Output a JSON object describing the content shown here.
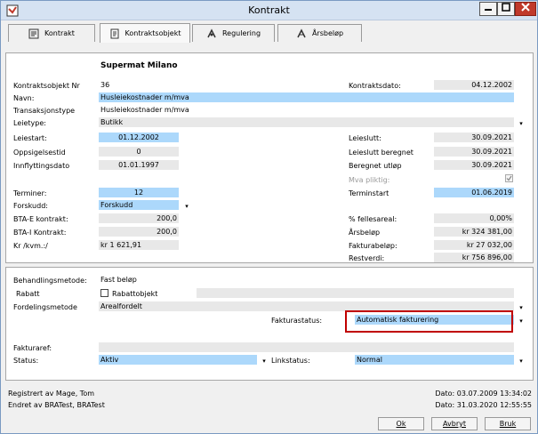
{
  "window": {
    "title": "Kontrakt"
  },
  "tabs": [
    {
      "label": "Kontrakt",
      "icon": "contract-icon"
    },
    {
      "label": "Kontraktsobjekt",
      "icon": "document-icon"
    },
    {
      "label": "Regulering",
      "icon": "adjustment-icon"
    },
    {
      "label": "Årsbeløp",
      "icon": "yearly-amount-icon"
    }
  ],
  "header": {
    "object_name": "Supermat Milano"
  },
  "top": {
    "kontraktsobjekt_nr": {
      "label": "Kontraktsobjekt Nr",
      "value": "36"
    },
    "kontraktsdato": {
      "label": "Kontraktsdato:",
      "value": "04.12.2002"
    },
    "navn": {
      "label": "Navn:",
      "value": "Husleiekostnader m/mva"
    },
    "transaksjonstype": {
      "label": "Transaksjonstype",
      "value": "Husleiekostnader m/mva"
    },
    "leietype": {
      "label": "Leietype:",
      "value": "Butikk"
    },
    "leiestart": {
      "label": "Leiestart:",
      "value": "01.12.2002"
    },
    "leieslutt": {
      "label": "Leieslutt:",
      "value": "30.09.2021"
    },
    "oppsigelsestid": {
      "label": "Oppsigelsestid",
      "value": "0"
    },
    "leieslutt_beregnet": {
      "label": "Leieslutt beregnet",
      "value": "30.09.2021"
    },
    "innflyttingsdato": {
      "label": "Innflyttingsdato",
      "value": "01.01.1997"
    },
    "beregnet_utlop": {
      "label": "Beregnet utløp",
      "value": "30.09.2021"
    },
    "mva_pliktig": {
      "label": "Mva pliktig:"
    },
    "terminer": {
      "label": "Terminer:",
      "value": "12"
    },
    "terminstart": {
      "label": "Terminstart",
      "value": "01.06.2019"
    },
    "forskudd": {
      "label": "Forskudd:",
      "value": "Forskudd"
    },
    "bta_e": {
      "label": "BTA-E kontrakt:",
      "value": "200,0"
    },
    "fellesareal": {
      "label": "% fellesareal:",
      "value": "0,00%"
    },
    "bta_i": {
      "label": "BTA-I Kontrakt:",
      "value": "200,0"
    },
    "arsbelop": {
      "label": "Årsbeløp",
      "value": "kr 324 381,00"
    },
    "kr_kvm": {
      "label": "Kr /kvm.:/",
      "value": "kr 1 621,91"
    },
    "fakturabelop": {
      "label": "Fakturabeløp:",
      "value": "kr 27 032,00"
    },
    "restverdi": {
      "label": "Restverdi:",
      "value": "kr 756 896,00"
    }
  },
  "bottom": {
    "behandlingsmetode": {
      "label": "Behandlingsmetode:",
      "value": "Fast beløp"
    },
    "rabatt": {
      "label": "Rabatt",
      "checkbox_label": "Rabattobjekt"
    },
    "fordelingsmetode": {
      "label": "Fordelingsmetode",
      "value": "Arealfordelt"
    },
    "fakturastatus": {
      "label": "Fakturastatus:",
      "value": "Automatisk fakturering"
    },
    "fakturaref": {
      "label": "Fakturaref:",
      "value": ""
    },
    "status": {
      "label": "Status:",
      "value": "Aktiv"
    },
    "linkstatus": {
      "label": "Linkstatus:",
      "value": "Normal"
    }
  },
  "footer": {
    "registrert": "Registrert av Mage, Tom",
    "endret": "Endret av BRATest, BRATest",
    "dato_registrert": "Dato: 03.07.2009 13:34:02",
    "dato_endret": "Dato: 31.03.2020 12:55:55"
  },
  "buttons": {
    "ok": "Ok",
    "avbryt": "Avbryt",
    "bruk": "Bruk"
  },
  "colors": {
    "field_blue": "#acd8fb",
    "field_grey": "#e8e8e8",
    "highlight": "#c00000"
  }
}
